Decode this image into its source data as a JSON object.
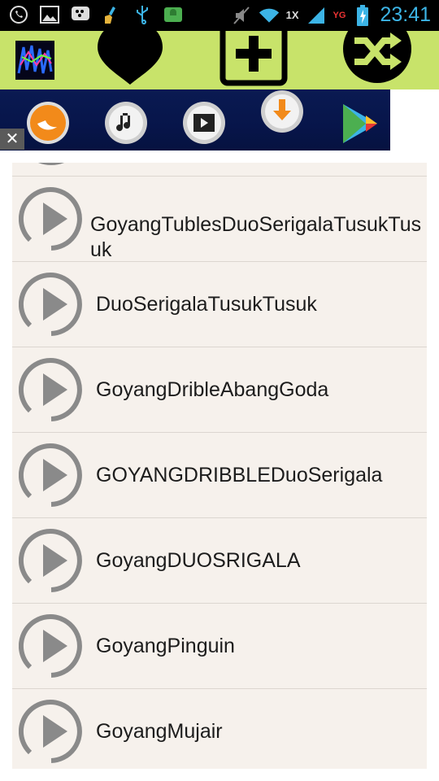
{
  "status_bar": {
    "time": "23:41",
    "network_label": "1X",
    "signal_label": "YG",
    "icons": [
      "whatsapp-icon",
      "gallery-icon",
      "bbm-icon",
      "broom-icon",
      "usb-icon",
      "android-debug-icon",
      "mute-icon",
      "wifi-icon",
      "signal-icon",
      "battery-charging-icon"
    ]
  },
  "app_bar": {
    "buttons": [
      "favorite-heart",
      "add-playlist",
      "shuffle"
    ]
  },
  "ad_banner": {
    "icons": [
      "uc-browser-icon",
      "music-icon",
      "video-icon",
      "download-icon",
      "play-store-icon"
    ],
    "close_label": "✕"
  },
  "playlist": {
    "items": [
      {
        "title": "GoyangTublesDuoSerigalaTusukTusuk"
      },
      {
        "title": "DuoSerigalaTusukTusuk"
      },
      {
        "title": "GoyangDribleAbangGoda"
      },
      {
        "title": "GOYANGDRIBBLEDuoSerigala"
      },
      {
        "title": "GoyangDUOSRIGALA"
      },
      {
        "title": "GoyangPinguin"
      },
      {
        "title": "GoyangMujair"
      }
    ]
  },
  "colors": {
    "app_bar": "#c8e36a",
    "list_bg": "#f6f1ec",
    "status_icon": "#3cb4e6"
  }
}
